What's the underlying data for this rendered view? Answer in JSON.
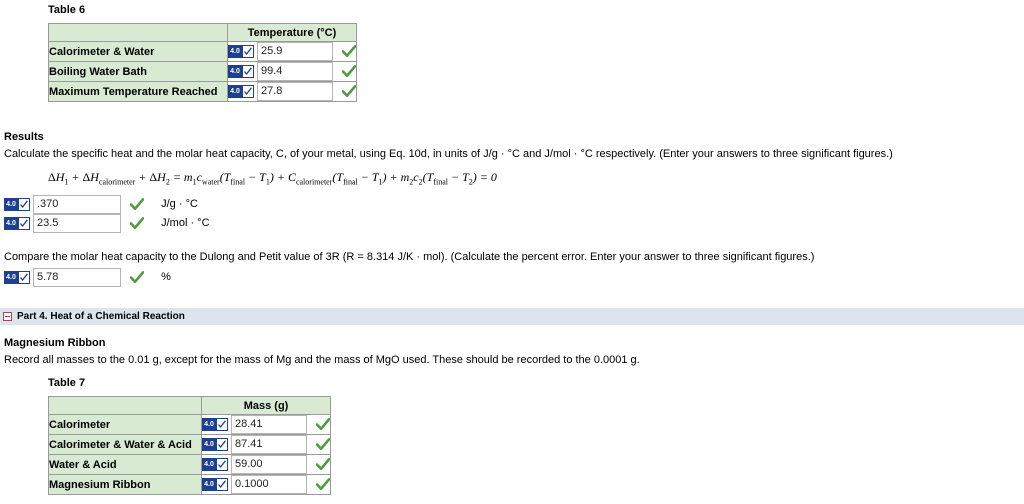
{
  "table6": {
    "caption": "Table 6",
    "header_blank": "",
    "header_value": "Temperature (°C)",
    "badge_label": "4.0",
    "rows": [
      {
        "label": "Calorimeter & Water",
        "value": "25.9",
        "graded": true
      },
      {
        "label": "Boiling Water Bath",
        "value": "99.4",
        "graded": true
      },
      {
        "label": "Maximum Temperature Reached",
        "value": "27.8",
        "graded": true
      }
    ]
  },
  "results": {
    "heading": "Results",
    "instruction": "Calculate the specific heat and the molar heat capacity, C, of your metal, using Eq. 10d, in units of J/g · °C and J/mol · °C respectively. (Enter your answers to three significant figures.)",
    "equation_text": "ΔH1 + ΔHcalorimeter + ΔH2 = m1cwater(Tfinal − T1) + Ccalorimeter(Tfinal − T1) + m2c2(Tfinal − T2) = 0",
    "badge_label": "4.0",
    "answers": [
      {
        "value": ".370",
        "unit": "J/g · °C",
        "graded": true
      },
      {
        "value": "23.5",
        "unit": "J/mol · °C",
        "graded": true
      }
    ],
    "compare_instruction": "Compare the molar heat capacity to the Dulong and Petit value of 3R (R = 8.314 J/K · mol). (Calculate the percent error. Enter your answer to three significant figures.)",
    "percent_answer": {
      "value": "5.78",
      "unit": "%",
      "graded": true
    }
  },
  "part4": {
    "title": "Part 4. Heat of a Chemical Reaction",
    "collapse_icon": "collapse-minus-icon",
    "subsection_heading": "Magnesium Ribbon",
    "subsection_text": "Record all masses to the 0.01 g, except for the mass of Mg and the mass of MgO used. These should be recorded to the 0.0001 g."
  },
  "table7": {
    "caption": "Table 7",
    "header_blank": "",
    "header_value": "Mass (g)",
    "badge_label": "4.0",
    "rows": [
      {
        "label": "Calorimeter",
        "value": "28.41",
        "graded": true
      },
      {
        "label": "Calorimeter & Water & Acid",
        "value": "87.41",
        "graded": true
      },
      {
        "label": "Water & Acid",
        "value": "59.00",
        "graded": true
      },
      {
        "label": "Magnesium Ribbon",
        "value": "0.1000",
        "graded": true
      }
    ]
  },
  "colors": {
    "table_header_green": "#d9ead3",
    "part_bar_blue": "#dce4ee",
    "badge_blue": "#1f3f8f",
    "check_green": "#3f9b3f",
    "collapse_red": "#a14b4b"
  }
}
